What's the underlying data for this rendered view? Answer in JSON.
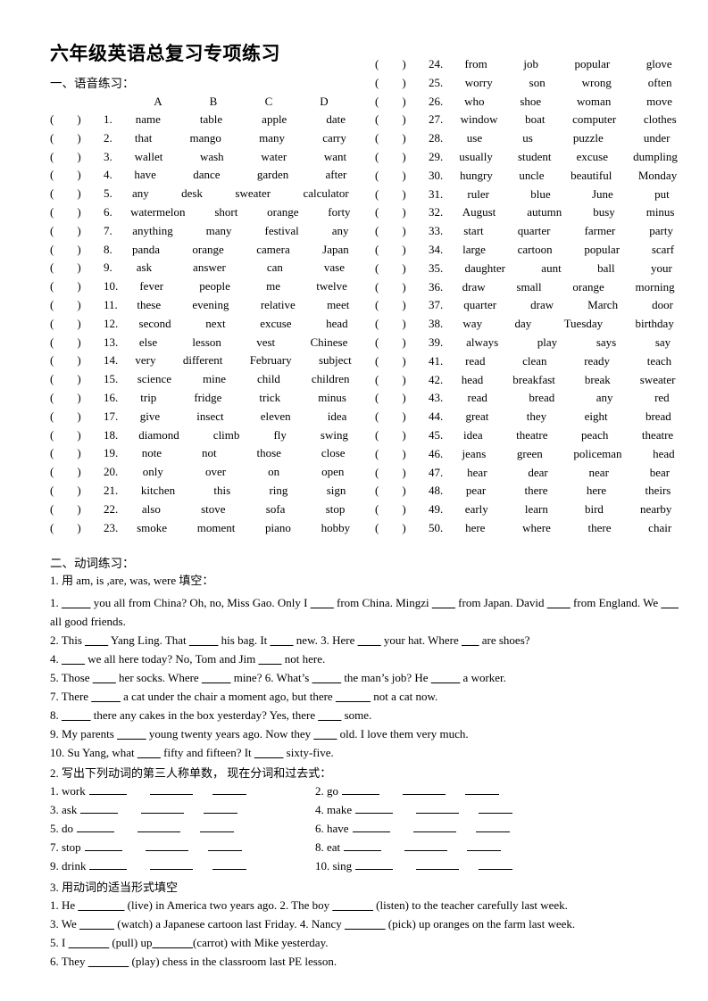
{
  "document": {
    "title": "六年级英语总复习专项练习",
    "section1_heading": "一、语音练习：",
    "section2_heading": "二、动词练习："
  },
  "phonetics": {
    "column_headers": [
      "A",
      "B",
      "C",
      "D"
    ],
    "paren": "(",
    "paren_close": ")",
    "items_left": [
      {
        "num": "1.",
        "words": [
          "name",
          "table",
          "apple",
          "date"
        ]
      },
      {
        "num": "2.",
        "words": [
          "that",
          "mango",
          "many",
          "carry"
        ]
      },
      {
        "num": "3.",
        "words": [
          "wallet",
          "wash",
          "water",
          "want"
        ]
      },
      {
        "num": "4.",
        "words": [
          "have",
          "dance",
          "garden",
          "after"
        ]
      },
      {
        "num": "5.",
        "words": [
          "any",
          "desk",
          "sweater",
          "calculator"
        ]
      },
      {
        "num": "6.",
        "words": [
          "watermelon",
          "short",
          "orange",
          "forty"
        ]
      },
      {
        "num": "7.",
        "words": [
          "anything",
          "many",
          "festival",
          "any"
        ]
      },
      {
        "num": "8.",
        "words": [
          "panda",
          "orange",
          "camera",
          "Japan"
        ]
      },
      {
        "num": "9.",
        "words": [
          "ask",
          "answer",
          "can",
          "vase"
        ]
      },
      {
        "num": "10.",
        "words": [
          "fever",
          "people",
          "me",
          "twelve"
        ]
      },
      {
        "num": "11.",
        "words": [
          "these",
          "evening",
          "relative",
          "meet"
        ]
      },
      {
        "num": "12.",
        "words": [
          "second",
          "next",
          "excuse",
          "head"
        ]
      },
      {
        "num": "13.",
        "words": [
          "else",
          "lesson",
          "vest",
          "Chinese"
        ]
      },
      {
        "num": "14.",
        "words": [
          "very",
          "different",
          "February",
          "subject"
        ]
      },
      {
        "num": "15.",
        "words": [
          "science",
          "mine",
          "child",
          "children"
        ]
      },
      {
        "num": "16.",
        "words": [
          "trip",
          "fridge",
          "trick",
          "minus"
        ]
      },
      {
        "num": "17.",
        "words": [
          "give",
          "insect",
          "eleven",
          "idea"
        ]
      },
      {
        "num": "18.",
        "words": [
          "diamond",
          "climb",
          "fly",
          "swing"
        ]
      },
      {
        "num": "19.",
        "words": [
          "note",
          "not",
          "those",
          "close"
        ]
      },
      {
        "num": "20.",
        "words": [
          "only",
          "over",
          "on",
          "open"
        ]
      },
      {
        "num": "21.",
        "words": [
          "kitchen",
          "this",
          "ring",
          "sign"
        ]
      },
      {
        "num": "22.",
        "words": [
          "also",
          "stove",
          "sofa",
          "stop"
        ]
      },
      {
        "num": "23.",
        "words": [
          "smoke",
          "moment",
          "piano",
          "hobby"
        ]
      }
    ],
    "items_right": [
      {
        "num": "24.",
        "words": [
          "from",
          "job",
          "popular",
          "glove"
        ]
      },
      {
        "num": "25.",
        "words": [
          "worry",
          "son",
          "wrong",
          "often"
        ]
      },
      {
        "num": "26.",
        "words": [
          "who",
          "shoe",
          "woman",
          "move"
        ]
      },
      {
        "num": "27.",
        "words": [
          "window",
          "boat",
          "computer",
          "clothes"
        ]
      },
      {
        "num": "28.",
        "words": [
          "use",
          "us",
          "puzzle",
          "under"
        ]
      },
      {
        "num": "29.",
        "words": [
          "usually",
          "student",
          "excuse",
          "dumpling"
        ]
      },
      {
        "num": "30.",
        "words": [
          "hungry",
          "uncle",
          "beautiful",
          "Monday"
        ]
      },
      {
        "num": "31.",
        "words": [
          "ruler",
          "blue",
          "June",
          "put"
        ]
      },
      {
        "num": "32.",
        "words": [
          "August",
          "autumn",
          "busy",
          "minus"
        ]
      },
      {
        "num": "33.",
        "words": [
          "start",
          "quarter",
          "farmer",
          "party"
        ]
      },
      {
        "num": "34.",
        "words": [
          "large",
          "cartoon",
          "popular",
          "scarf"
        ]
      },
      {
        "num": "35.",
        "words": [
          "daughter",
          "aunt",
          "ball",
          "your"
        ]
      },
      {
        "num": "36.",
        "words": [
          "draw",
          "small",
          "orange",
          "morning"
        ]
      },
      {
        "num": "37.",
        "words": [
          "quarter",
          "draw",
          "March",
          "door"
        ]
      },
      {
        "num": "38.",
        "words": [
          "way",
          "day",
          "Tuesday",
          "birthday"
        ]
      },
      {
        "num": "39.",
        "words": [
          "always",
          "play",
          "says",
          "say"
        ]
      },
      {
        "num": "41.",
        "words": [
          "read",
          "clean",
          "ready",
          "teach"
        ]
      },
      {
        "num": "42.",
        "words": [
          "head",
          "breakfast",
          "break",
          "sweater"
        ]
      },
      {
        "num": "43.",
        "words": [
          "read",
          "bread",
          "any",
          "red"
        ]
      },
      {
        "num": "44.",
        "words": [
          "great",
          "they",
          "eight",
          "bread"
        ]
      },
      {
        "num": "45.",
        "words": [
          "idea",
          "theatre",
          "peach",
          "theatre"
        ]
      },
      {
        "num": "46.",
        "words": [
          "jeans",
          "green",
          "policeman",
          "head"
        ]
      },
      {
        "num": "47.",
        "words": [
          "hear",
          "dear",
          "near",
          "bear"
        ]
      },
      {
        "num": "48.",
        "words": [
          "pear",
          "there",
          "here",
          "theirs"
        ]
      },
      {
        "num": "49.",
        "words": [
          "early",
          "learn",
          "bird",
          "nearby"
        ]
      },
      {
        "num": "50.",
        "words": [
          "here",
          "where",
          "there",
          "chair"
        ]
      }
    ]
  },
  "verbs": {
    "fill_heading": "1. 用 am, is ,are, was, were  填空：",
    "fill_lines": [
      "1. _____ you all from China? Oh, no, Miss Gao. Only I ____      from China. Mingzi ____ from Japan. David ____ from England. We ___ all good friends.",
      "2. This ____ Yang Ling. That _____ his bag. It ____ new. 3. Here ____ your hat. Where ___ are shoes?",
      "4. ____ we all here today? No, Tom and Jim ____ not here.",
      "5. Those ____ her socks. Where _____ mine? 6. What’s _____ the man’s job? He _____ a worker.",
      "7. There _____ a cat under the chair a moment ago, but there ______ not a cat now.",
      "8. _____ there any cakes in the box yesterday? Yes, there ____ some.",
      "9. My parents _____ young twenty years ago. Now they ____ old. I love them very much.",
      "10. Su Yang, what ____ fifty and fifteen? It _____ sixty-five."
    ],
    "conj_heading": "2. 写出下列动词的第三人称单数，  现在分词和过去式：",
    "conj_items": [
      {
        "num": "1.",
        "verb": "work"
      },
      {
        "num": "2.",
        "verb": "go"
      },
      {
        "num": "3.",
        "verb": "ask"
      },
      {
        "num": "4.",
        "verb": "make"
      },
      {
        "num": "5.",
        "verb": "do"
      },
      {
        "num": "6.",
        "verb": "have"
      },
      {
        "num": "7.",
        "verb": "stop"
      },
      {
        "num": "8.",
        "verb": "eat"
      },
      {
        "num": "9.",
        "verb": "drink"
      },
      {
        "num": "10.",
        "verb": "sing"
      }
    ],
    "forms_heading": "3. 用动词的适当形式填空",
    "forms_lines": [
      "1. He ________ (live) in America two years ago. 2. The boy _______ (listen) to the teacher carefully last week.",
      "3. We ______ (watch) a Japanese cartoon last Friday.    4. Nancy _______ (pick) up oranges on the farm last week.",
      "5. I _______ (pull) up_______(carrot) with Mike yesterday.",
      "6. They _______ (play) chess in the classroom last PE lesson."
    ]
  }
}
